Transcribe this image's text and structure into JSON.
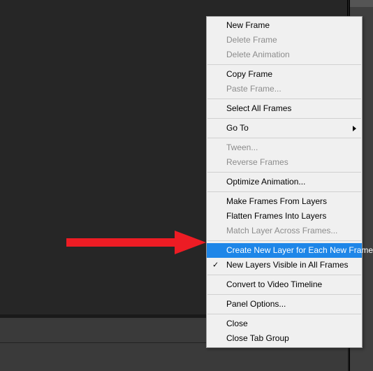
{
  "menu": {
    "groups": [
      [
        {
          "label": "New Frame",
          "disabled": false,
          "highlighted": false,
          "submenu": false,
          "checked": false
        },
        {
          "label": "Delete Frame",
          "disabled": true,
          "highlighted": false,
          "submenu": false,
          "checked": false
        },
        {
          "label": "Delete Animation",
          "disabled": true,
          "highlighted": false,
          "submenu": false,
          "checked": false
        }
      ],
      [
        {
          "label": "Copy Frame",
          "disabled": false,
          "highlighted": false,
          "submenu": false,
          "checked": false
        },
        {
          "label": "Paste Frame...",
          "disabled": true,
          "highlighted": false,
          "submenu": false,
          "checked": false
        }
      ],
      [
        {
          "label": "Select All Frames",
          "disabled": false,
          "highlighted": false,
          "submenu": false,
          "checked": false
        }
      ],
      [
        {
          "label": "Go To",
          "disabled": false,
          "highlighted": false,
          "submenu": true,
          "checked": false
        }
      ],
      [
        {
          "label": "Tween...",
          "disabled": true,
          "highlighted": false,
          "submenu": false,
          "checked": false
        },
        {
          "label": "Reverse Frames",
          "disabled": true,
          "highlighted": false,
          "submenu": false,
          "checked": false
        }
      ],
      [
        {
          "label": "Optimize Animation...",
          "disabled": false,
          "highlighted": false,
          "submenu": false,
          "checked": false
        }
      ],
      [
        {
          "label": "Make Frames From Layers",
          "disabled": false,
          "highlighted": false,
          "submenu": false,
          "checked": false
        },
        {
          "label": "Flatten Frames Into Layers",
          "disabled": false,
          "highlighted": false,
          "submenu": false,
          "checked": false
        },
        {
          "label": "Match Layer Across Frames...",
          "disabled": true,
          "highlighted": false,
          "submenu": false,
          "checked": false
        }
      ],
      [
        {
          "label": "Create New Layer for Each New Frame",
          "disabled": false,
          "highlighted": true,
          "submenu": false,
          "checked": false
        },
        {
          "label": "New Layers Visible in All Frames",
          "disabled": false,
          "highlighted": false,
          "submenu": false,
          "checked": true
        }
      ],
      [
        {
          "label": "Convert to Video Timeline",
          "disabled": false,
          "highlighted": false,
          "submenu": false,
          "checked": false
        }
      ],
      [
        {
          "label": "Panel Options...",
          "disabled": false,
          "highlighted": false,
          "submenu": false,
          "checked": false
        }
      ],
      [
        {
          "label": "Close",
          "disabled": false,
          "highlighted": false,
          "submenu": false,
          "checked": false
        },
        {
          "label": "Close Tab Group",
          "disabled": false,
          "highlighted": false,
          "submenu": false,
          "checked": false
        }
      ]
    ]
  },
  "annotation": {
    "arrow_color": "#ed1c24"
  }
}
